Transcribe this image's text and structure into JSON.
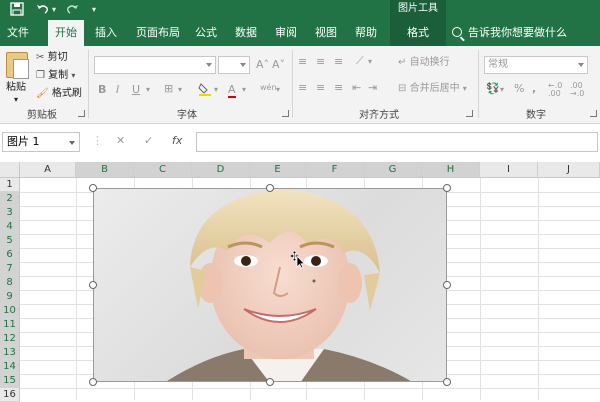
{
  "titlebar": {
    "save_icon": "save-icon",
    "undo_icon": "undo-icon",
    "redo_icon": "redo-icon",
    "customize_icon": "customize-qat-icon",
    "context_tab_title": "图片工具"
  },
  "tabs": [
    {
      "label": "文件"
    },
    {
      "label": "开始"
    },
    {
      "label": "插入"
    },
    {
      "label": "页面布局"
    },
    {
      "label": "公式"
    },
    {
      "label": "数据"
    },
    {
      "label": "审阅"
    },
    {
      "label": "视图"
    },
    {
      "label": "帮助"
    },
    {
      "label": "格式"
    }
  ],
  "tell_me": "告诉我你想要做什么",
  "ribbon": {
    "clipboard": {
      "paste": "粘贴",
      "cut": "剪切",
      "copy": "复制",
      "format_painter": "格式刷",
      "group_label": "剪贴板"
    },
    "font": {
      "font_name": "",
      "font_size": "",
      "grow": "A˄",
      "shrink": "A˅",
      "bold": "B",
      "italic": "I",
      "underline": "U",
      "font_color": "A",
      "phonetic": "wén",
      "group_label": "字体"
    },
    "alignment": {
      "wrap_text": "自动换行",
      "merge_center": "合并后居中",
      "group_label": "对齐方式"
    },
    "number": {
      "format": "常规",
      "percent": "%",
      "comma": ",",
      "group_label": "数字"
    }
  },
  "formula_bar": {
    "name_box": "图片 1",
    "cancel": "✕",
    "enter": "✓",
    "fx": "fx",
    "content": ""
  },
  "grid": {
    "columns": [
      "A",
      "B",
      "C",
      "D",
      "E",
      "F",
      "G",
      "H",
      "I",
      "J"
    ],
    "rows": [
      "1",
      "2",
      "3",
      "4",
      "5",
      "6",
      "7",
      "8",
      "9",
      "10",
      "11",
      "12",
      "13",
      "14",
      "15",
      "16"
    ],
    "selected_columns": [
      "B",
      "C",
      "D",
      "E",
      "F",
      "G",
      "H"
    ],
    "selected_rows": [
      "2",
      "3",
      "4",
      "5",
      "6",
      "7",
      "8",
      "9",
      "10",
      "11",
      "12",
      "13",
      "14",
      "15"
    ]
  },
  "picture": {
    "name": "图片 1",
    "subject": "portrait-photo"
  },
  "colors": {
    "excel_green": "#217346",
    "ribbon_bg": "#f3f3f3"
  }
}
